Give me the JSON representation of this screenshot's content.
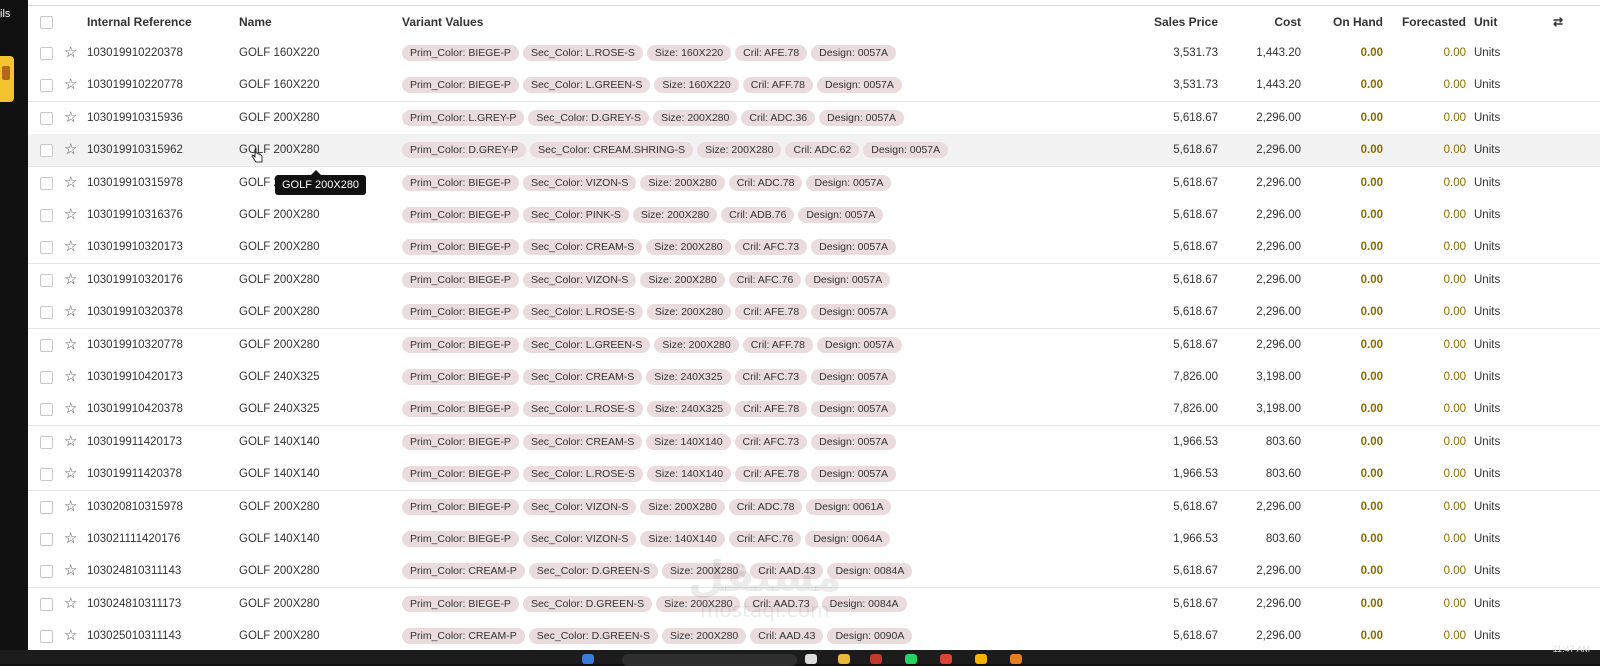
{
  "left_strip_text": "ils",
  "tooltip": "GOLF 200X280",
  "watermark": {
    "line1": "مستقل",
    "line2": "mostaql.com"
  },
  "taskbar": {
    "time": "11:47 AM"
  },
  "columns": {
    "ref": "Internal Reference",
    "name": "Name",
    "variant": "Variant Values",
    "sales": "Sales Price",
    "cost": "Cost",
    "onhand": "On Hand",
    "forecasted": "Forecasted",
    "unit": "Unit"
  },
  "rows": [
    {
      "ref": "103019910220378",
      "name": "GOLF 160X220",
      "tags": [
        "Prim_Color: BIEGE-P",
        "Sec_Color: L.ROSE-S",
        "Size: 160X220",
        "Cril: AFE.78",
        "Design: 0057A"
      ],
      "sales": "3,531.73",
      "cost": "1,443.20",
      "onhand": "0.00",
      "forecasted": "0.00",
      "unit": "Units"
    },
    {
      "ref": "103019910220778",
      "name": "GOLF 160X220",
      "tags": [
        "Prim_Color: BIEGE-P",
        "Sec_Color: L.GREEN-S",
        "Size: 160X220",
        "Cril: AFF.78",
        "Design: 0057A"
      ],
      "sales": "3,531.73",
      "cost": "1,443.20",
      "onhand": "0.00",
      "forecasted": "0.00",
      "unit": "Units"
    },
    {
      "ref": "103019910315936",
      "name": "GOLF 200X280",
      "tags": [
        "Prim_Color: L.GREY-P",
        "Sec_Color: D.GREY-S",
        "Size: 200X280",
        "Cril: ADC.36",
        "Design: 0057A"
      ],
      "sales": "5,618.67",
      "cost": "2,296.00",
      "onhand": "0.00",
      "forecasted": "0.00",
      "unit": "Units"
    },
    {
      "ref": "103019910315962",
      "name": "GOLF 200X280",
      "tags": [
        "Prim_Color: D.GREY-P",
        "Sec_Color: CREAM.SHRING-S",
        "Size: 200X280",
        "Cril: ADC.62",
        "Design: 0057A"
      ],
      "sales": "5,618.67",
      "cost": "2,296.00",
      "onhand": "0.00",
      "forecasted": "0.00",
      "unit": "Units"
    },
    {
      "ref": "103019910315978",
      "name": "GOLF 2",
      "tags": [
        "Prim_Color: BIEGE-P",
        "Sec_Color: VIZON-S",
        "Size: 200X280",
        "Cril: ADC.78",
        "Design: 0057A"
      ],
      "sales": "5,618.67",
      "cost": "2,296.00",
      "onhand": "0.00",
      "forecasted": "0.00",
      "unit": "Units"
    },
    {
      "ref": "103019910316376",
      "name": "GOLF 200X280",
      "tags": [
        "Prim_Color: BIEGE-P",
        "Sec_Color: PINK-S",
        "Size: 200X280",
        "Cril: ADB.76",
        "Design: 0057A"
      ],
      "sales": "5,618.67",
      "cost": "2,296.00",
      "onhand": "0.00",
      "forecasted": "0.00",
      "unit": "Units"
    },
    {
      "ref": "103019910320173",
      "name": "GOLF 200X280",
      "tags": [
        "Prim_Color: BIEGE-P",
        "Sec_Color: CREAM-S",
        "Size: 200X280",
        "Cril: AFC.73",
        "Design: 0057A"
      ],
      "sales": "5,618.67",
      "cost": "2,296.00",
      "onhand": "0.00",
      "forecasted": "0.00",
      "unit": "Units"
    },
    {
      "ref": "103019910320176",
      "name": "GOLF 200X280",
      "tags": [
        "Prim_Color: BIEGE-P",
        "Sec_Color: VIZON-S",
        "Size: 200X280",
        "Cril: AFC.76",
        "Design: 0057A"
      ],
      "sales": "5,618.67",
      "cost": "2,296.00",
      "onhand": "0.00",
      "forecasted": "0.00",
      "unit": "Units"
    },
    {
      "ref": "103019910320378",
      "name": "GOLF 200X280",
      "tags": [
        "Prim_Color: BIEGE-P",
        "Sec_Color: L.ROSE-S",
        "Size: 200X280",
        "Cril: AFE.78",
        "Design: 0057A"
      ],
      "sales": "5,618.67",
      "cost": "2,296.00",
      "onhand": "0.00",
      "forecasted": "0.00",
      "unit": "Units"
    },
    {
      "ref": "103019910320778",
      "name": "GOLF 200X280",
      "tags": [
        "Prim_Color: BIEGE-P",
        "Sec_Color: L.GREEN-S",
        "Size: 200X280",
        "Cril: AFF.78",
        "Design: 0057A"
      ],
      "sales": "5,618.67",
      "cost": "2,296.00",
      "onhand": "0.00",
      "forecasted": "0.00",
      "unit": "Units"
    },
    {
      "ref": "103019910420173",
      "name": "GOLF 240X325",
      "tags": [
        "Prim_Color: BIEGE-P",
        "Sec_Color: CREAM-S",
        "Size: 240X325",
        "Cril: AFC.73",
        "Design: 0057A"
      ],
      "sales": "7,826.00",
      "cost": "3,198.00",
      "onhand": "0.00",
      "forecasted": "0.00",
      "unit": "Units"
    },
    {
      "ref": "103019910420378",
      "name": "GOLF 240X325",
      "tags": [
        "Prim_Color: BIEGE-P",
        "Sec_Color: L.ROSE-S",
        "Size: 240X325",
        "Cril: AFE.78",
        "Design: 0057A"
      ],
      "sales": "7,826.00",
      "cost": "3,198.00",
      "onhand": "0.00",
      "forecasted": "0.00",
      "unit": "Units"
    },
    {
      "ref": "103019911420173",
      "name": "GOLF 140X140",
      "tags": [
        "Prim_Color: BIEGE-P",
        "Sec_Color: CREAM-S",
        "Size: 140X140",
        "Cril: AFC.73",
        "Design: 0057A"
      ],
      "sales": "1,966.53",
      "cost": "803.60",
      "onhand": "0.00",
      "forecasted": "0.00",
      "unit": "Units"
    },
    {
      "ref": "103019911420378",
      "name": "GOLF 140X140",
      "tags": [
        "Prim_Color: BIEGE-P",
        "Sec_Color: L.ROSE-S",
        "Size: 140X140",
        "Cril: AFE.78",
        "Design: 0057A"
      ],
      "sales": "1,966.53",
      "cost": "803.60",
      "onhand": "0.00",
      "forecasted": "0.00",
      "unit": "Units"
    },
    {
      "ref": "103020810315978",
      "name": "GOLF 200X280",
      "tags": [
        "Prim_Color: BIEGE-P",
        "Sec_Color: VIZON-S",
        "Size: 200X280",
        "Cril: ADC.78",
        "Design: 0061A"
      ],
      "sales": "5,618.67",
      "cost": "2,296.00",
      "onhand": "0.00",
      "forecasted": "0.00",
      "unit": "Units"
    },
    {
      "ref": "103021111420176",
      "name": "GOLF 140X140",
      "tags": [
        "Prim_Color: BIEGE-P",
        "Sec_Color: VIZON-S",
        "Size: 140X140",
        "Cril: AFC.76",
        "Design: 0064A"
      ],
      "sales": "1,966.53",
      "cost": "803.60",
      "onhand": "0.00",
      "forecasted": "0.00",
      "unit": "Units"
    },
    {
      "ref": "103024810311143",
      "name": "GOLF 200X280",
      "tags": [
        "Prim_Color: CREAM-P",
        "Sec_Color: D.GREEN-S",
        "Size: 200X280",
        "Cril: AAD.43",
        "Design: 0084A"
      ],
      "sales": "5,618.67",
      "cost": "2,296.00",
      "onhand": "0.00",
      "forecasted": "0.00",
      "unit": "Units"
    },
    {
      "ref": "103024810311173",
      "name": "GOLF 200X280",
      "tags": [
        "Prim_Color: BIEGE-P",
        "Sec_Color: D.GREEN-S",
        "Size: 200X280",
        "Cril: AAD.73",
        "Design: 0084A"
      ],
      "sales": "5,618.67",
      "cost": "2,296.00",
      "onhand": "0.00",
      "forecasted": "0.00",
      "unit": "Units"
    },
    {
      "ref": "103025010311143",
      "name": "GOLF 200X280",
      "tags": [
        "Prim_Color: CREAM-P",
        "Sec_Color: D.GREEN-S",
        "Size: 200X280",
        "Cril: AAD.43",
        "Design: 0090A"
      ],
      "sales": "5,618.67",
      "cost": "2,296.00",
      "onhand": "0.00",
      "forecasted": "0.00",
      "unit": "Units"
    }
  ]
}
